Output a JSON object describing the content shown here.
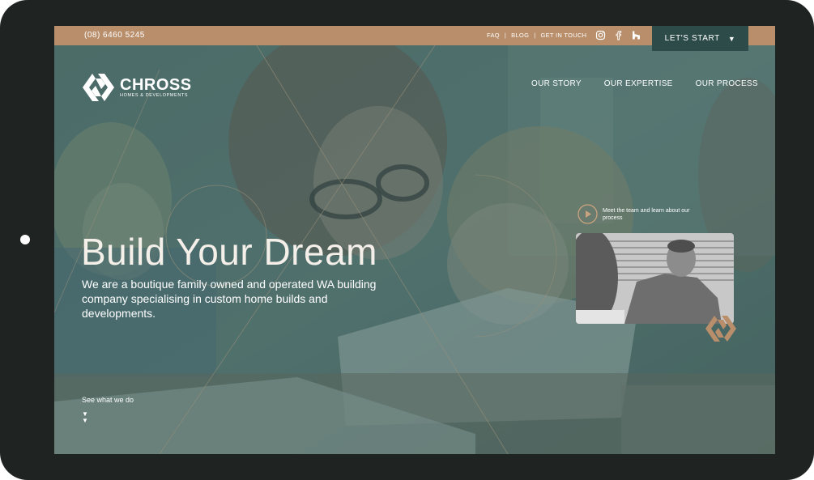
{
  "topbar": {
    "phone": "(08) 6460 5245",
    "links": [
      "FAQ",
      "BLOG",
      "GET IN TOUCH"
    ],
    "separator": "|",
    "social_icons": [
      "instagram-icon",
      "facebook-icon",
      "houzz-icon"
    ],
    "cta_label": "LET'S START",
    "cta_arrow": "▼"
  },
  "logo": {
    "name": "CHROSS",
    "subtitle": "HOMES & DEVELOPMENTS"
  },
  "nav": {
    "items": [
      "OUR STORY",
      "OUR EXPERTISE",
      "OUR PROCESS"
    ]
  },
  "hero": {
    "title": "Build Your Dream",
    "subtitle": "We are a boutique family owned and operated WA building company specialising in custom home builds and developments.",
    "scroll_label": "See what we do",
    "scroll_arrows": "▼▼"
  },
  "video": {
    "label": "Meet the team and learn about our process"
  },
  "colors": {
    "accent": "#b88e6b",
    "cta_bg": "#2d4b49",
    "overlay": "#4f6a66",
    "frame": "#1f2322"
  }
}
